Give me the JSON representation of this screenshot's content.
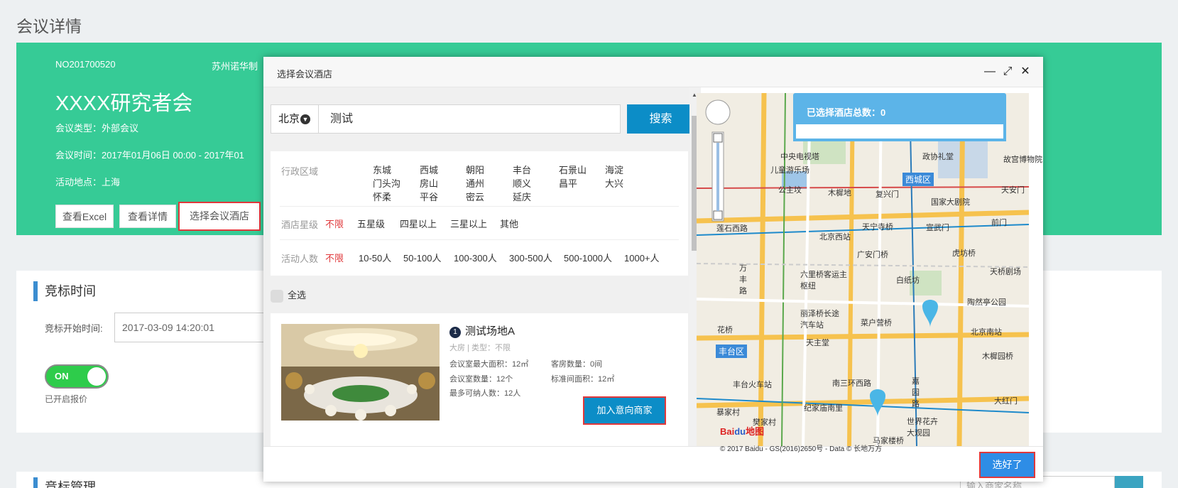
{
  "page": {
    "title": "会议详情"
  },
  "meeting": {
    "no": "NO201700520",
    "company": "苏州诺华制",
    "name": "XXXX研究者会",
    "type": "会议类型：外部会议",
    "time": "会议时间：2017年01月06日 00:00 - 2017年01",
    "location": "活动地点：上海",
    "buttons": {
      "excel": "查看Excel",
      "detail": "查看详情",
      "hotel": "选择会议酒店"
    }
  },
  "bidding": {
    "title": "竞标时间",
    "start_label": "竞标开始时间:",
    "start_value": "2017-03-09 14:20:01",
    "toggle": "ON",
    "toggle_note": "已开启报价",
    "toggle_on": true
  },
  "bidmgmt": {
    "title": "竞标管理",
    "search_placeholder": "输入商家名称"
  },
  "modal": {
    "title": "选择会议酒店",
    "controls": {
      "minimize": "—",
      "maximize": "⤢",
      "close": "✕"
    },
    "city": "北京",
    "query": "测试",
    "search_button": "搜索",
    "filters": {
      "district_label": "行政区域",
      "districts": [
        "东城",
        "西城",
        "朝阳",
        "丰台",
        "石景山",
        "海淀",
        "门头沟",
        "房山",
        "通州",
        "顺义",
        "昌平",
        "大兴",
        "怀柔",
        "平谷",
        "密云",
        "延庆"
      ],
      "star_label": "酒店星级",
      "stars": [
        "不限",
        "五星级",
        "四星以上",
        "三星以上",
        "其他"
      ],
      "people_label": "活动人数",
      "people": [
        "不限",
        "10-50人",
        "50-100人",
        "100-300人",
        "300-500人",
        "500-1000人",
        "1000+人"
      ]
    },
    "select_all": "全选",
    "hotel": {
      "index": "1",
      "name": "测试场地A",
      "type": "大房 | 类型：不限",
      "max_area": "会议室最大面积：12㎡",
      "room_count": "客房数量：0间",
      "meeting_rooms": "会议室数量：12个",
      "standard_area": "标准间面积：12㎡",
      "capacity": "最多可纳人数：12人",
      "add_button": "加入意向商家"
    },
    "map": {
      "selected_count": "已选择酒店总数：0",
      "labels": [
        "中央电视塔",
        "儿童游乐场",
        "公主坟",
        "木樨地",
        "复兴门",
        "西城区",
        "政协礼堂",
        "故宫博物院",
        "天安门",
        "国家大剧院",
        "前门",
        "莲石西路",
        "北京西站",
        "天宁寺桥",
        "宣武门",
        "广安门桥",
        "虎坊桥",
        "天桥剧场",
        "六里桥客运主枢纽",
        "白纸坊",
        "陶然亭公园",
        "丽泽桥长途汽车站",
        "菜户营桥",
        "北京南站",
        "天主堂",
        "木樨园桥",
        "丰台区",
        "丰台火车站",
        "南三环西路",
        "嘉园路",
        "大红门",
        "纪家庙南里",
        "世界花卉大观园",
        "樊家村",
        "马家楼桥",
        "暴家村",
        "万丰路",
        "花桥"
      ],
      "copyright": "© 2017 Baidu - GS(2016)2650号 - Data © 长地万方"
    },
    "done_button": "选好了"
  },
  "colors": {
    "banner": "#36cb96",
    "primary": "#0c8dc7",
    "highlight": "#e0383b"
  }
}
